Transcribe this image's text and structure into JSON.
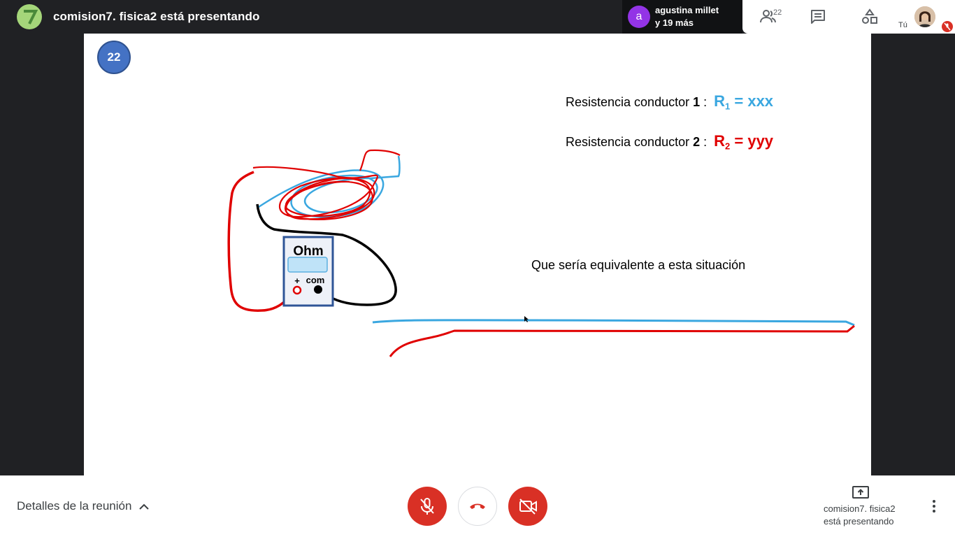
{
  "topbar": {
    "presenter_title": "comision7. fisica2 está presentando",
    "participant_chip": {
      "avatar_letter": "a",
      "name": "agustina millet",
      "more": "y 19 más"
    },
    "people_count": "22",
    "you_label": "Tú",
    "icons": [
      "people-icon",
      "chat-icon",
      "activities-icon",
      "mic-off-icon"
    ]
  },
  "slide": {
    "number": "22",
    "resistance_1": {
      "label": "Resistencia conductor ",
      "index": "1",
      "colon": " :",
      "symbol": "R",
      "subscript": "1",
      "value": " = xxx"
    },
    "resistance_2": {
      "label": "Resistencia conductor ",
      "index": "2",
      "colon": " :",
      "symbol": "R",
      "subscript": "2",
      "value": " = yyy"
    },
    "situation_text": "Que sería equivalente a esta situación",
    "meter": {
      "title": "Ohm",
      "plus": "+",
      "com": "com"
    },
    "colors": {
      "wire_1": "#3aa7e0",
      "wire_2": "#e00000",
      "lead": "#000000",
      "meter_frame": "#2f5597"
    }
  },
  "bottombar": {
    "meeting_details": "Detalles de la reunión",
    "present_line1": "comision7. fisica2",
    "present_line2": "está presentando",
    "icons": [
      "mic-off-icon",
      "hangup-icon",
      "camera-off-icon",
      "present-icon",
      "more-vert-icon"
    ]
  }
}
